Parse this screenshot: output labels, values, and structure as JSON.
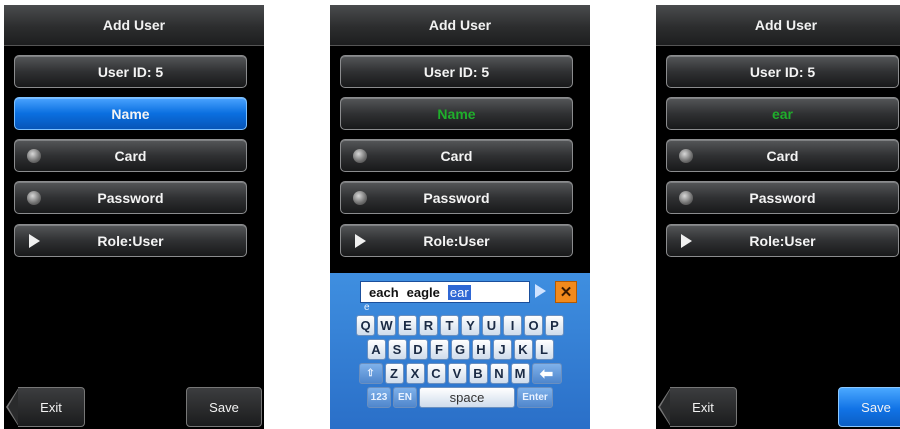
{
  "screens": [
    {
      "title": "Add User",
      "user_id": "User ID: 5",
      "name": "Name",
      "card": "Card",
      "password": "Password",
      "role": "Role:User",
      "exit": "Exit",
      "save": "Save"
    },
    {
      "title": "Add User",
      "user_id": "User ID: 5",
      "name": "Name",
      "card": "Card",
      "password": "Password",
      "role": "Role:User",
      "keyboard": {
        "candidates": [
          "each",
          "eagle",
          "ear"
        ],
        "pinyin": "e",
        "row1": [
          "Q",
          "W",
          "E",
          "R",
          "T",
          "Y",
          "U",
          "I",
          "O",
          "P"
        ],
        "row2": [
          "A",
          "S",
          "D",
          "F",
          "G",
          "H",
          "J",
          "K",
          "L"
        ],
        "row3": [
          "Z",
          "X",
          "C",
          "V",
          "B",
          "N",
          "M"
        ],
        "key_123": "123",
        "key_en": "EN",
        "key_space": "space",
        "key_enter": "Enter",
        "close_glyph": "✕",
        "shift_glyph": "⇧",
        "back_glyph": "⬅"
      }
    },
    {
      "title": "Add User",
      "user_id": "User ID: 5",
      "name": "ear",
      "card": "Card",
      "password": "Password",
      "role": "Role:User",
      "exit": "Exit",
      "save": "Save"
    }
  ],
  "colors": {
    "selected_blue": "#0a6fe0",
    "input_green": "#1fae2b",
    "save_active": "#1173e6"
  }
}
